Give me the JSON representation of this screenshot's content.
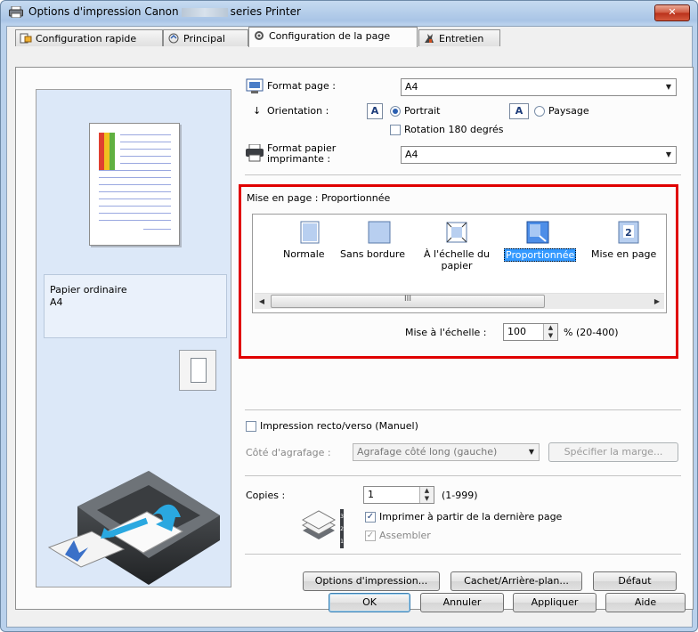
{
  "window": {
    "title_prefix": "Options d'impression Canon",
    "title_suffix": "series Printer",
    "close_label": "✕"
  },
  "tabs": [
    {
      "label": "Configuration rapide",
      "icon": "quick-setup-icon"
    },
    {
      "label": "Principal",
      "icon": "main-icon"
    },
    {
      "label": "Configuration de la page",
      "icon": "page-setup-icon",
      "active": true
    },
    {
      "label": "Entretien",
      "icon": "maintenance-icon"
    }
  ],
  "preview": {
    "media_type": "Papier ordinaire",
    "media_size": "A4"
  },
  "page_setup": {
    "format_page_label": "Format page :",
    "format_page_value": "A4",
    "orientation_label": "Orientation :",
    "orientation_options": [
      {
        "label": "Portrait",
        "selected": true
      },
      {
        "label": "Paysage",
        "selected": false
      }
    ],
    "rotation_label": "Rotation 180 degrés",
    "rotation_checked": false,
    "printer_paper_label_1": "Format papier",
    "printer_paper_label_2": "imprimante :",
    "printer_paper_value": "A4"
  },
  "layout": {
    "title_label": "Mise en page :",
    "title_value": "Proportionnée",
    "items": [
      {
        "label": "Normale",
        "icon": "normal-size-icon"
      },
      {
        "label": "Sans bordure",
        "icon": "borderless-icon"
      },
      {
        "label": "À l'échelle du",
        "label2": "papier",
        "icon": "fit-to-paper-icon"
      },
      {
        "label": "Proportionnée",
        "icon": "scaled-icon",
        "selected": true
      },
      {
        "label": "Mise en page",
        "icon": "page-layout-icon"
      }
    ],
    "scroll_grip": "III",
    "scale_label": "Mise à l'échelle :",
    "scale_value": "100",
    "scale_range": "% (20-400)"
  },
  "duplex": {
    "label": "Impression recto/verso (Manuel)",
    "checked": false,
    "stapling_label": "Côté d'agrafage :",
    "stapling_value": "Agrafage côté long (gauche)",
    "margin_button": "Spécifier la marge..."
  },
  "copies": {
    "label": "Copies :",
    "value": "1",
    "range": "(1-999)",
    "last_page_label": "Imprimer à partir de la dernière page",
    "last_page_checked": true,
    "collate_label": "Assembler",
    "collate_checked": true
  },
  "buttons": {
    "print_options": "Options d'impression...",
    "stamp_background": "Cachet/Arrière-plan...",
    "defaults": "Défaut",
    "ok": "OK",
    "cancel": "Annuler",
    "apply": "Appliquer",
    "help": "Aide"
  }
}
